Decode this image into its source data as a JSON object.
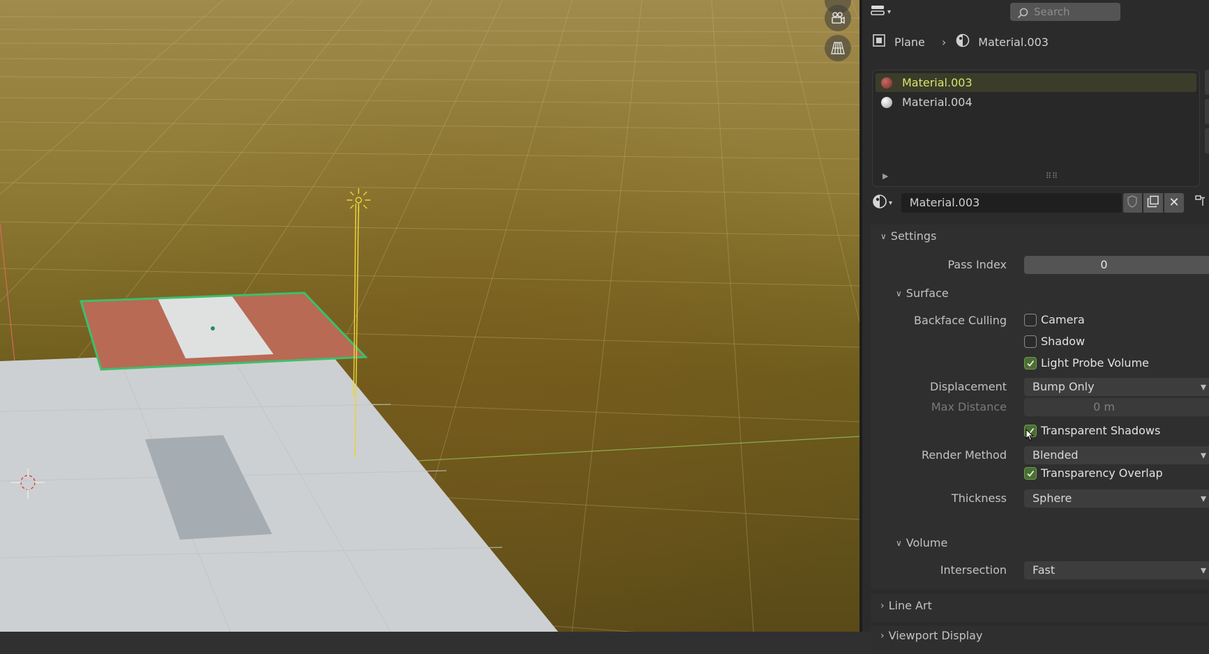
{
  "header": {
    "search_placeholder": "Search"
  },
  "breadcrumb": {
    "object": "Plane",
    "material": "Material.003"
  },
  "material_slots": [
    {
      "name": "Material.003",
      "active": true,
      "color": "#9c4a44"
    },
    {
      "name": "Material.004",
      "active": false,
      "color": "#e8e8e8"
    }
  ],
  "material_selector": {
    "name": "Material.003"
  },
  "settings": {
    "title": "Settings",
    "pass_index_label": "Pass Index",
    "pass_index_value": "0",
    "surface": {
      "title": "Surface",
      "backface_culling_label": "Backface Culling",
      "camera_label": "Camera",
      "camera_checked": false,
      "shadow_label": "Shadow",
      "shadow_checked": false,
      "light_probe_label": "Light Probe Volume",
      "light_probe_checked": true,
      "displacement_label": "Displacement",
      "displacement_value": "Bump Only",
      "max_distance_label": "Max Distance",
      "max_distance_value": "0 m",
      "transparent_shadows_label": "Transparent Shadows",
      "transparent_shadows_checked": true,
      "render_method_label": "Render Method",
      "render_method_value": "Blended",
      "transparency_overlap_label": "Transparency Overlap",
      "transparency_overlap_checked": true,
      "thickness_label": "Thickness",
      "thickness_value": "Sphere"
    },
    "volume": {
      "title": "Volume",
      "intersection_label": "Intersection",
      "intersection_value": "Fast"
    }
  },
  "collapsed_panels": [
    "Line Art",
    "Viewport Display"
  ],
  "colors": {
    "accent_active": "#d8e46a",
    "checkbox_on": "#4b6e34",
    "selection_outline": "#3dbf6a"
  }
}
